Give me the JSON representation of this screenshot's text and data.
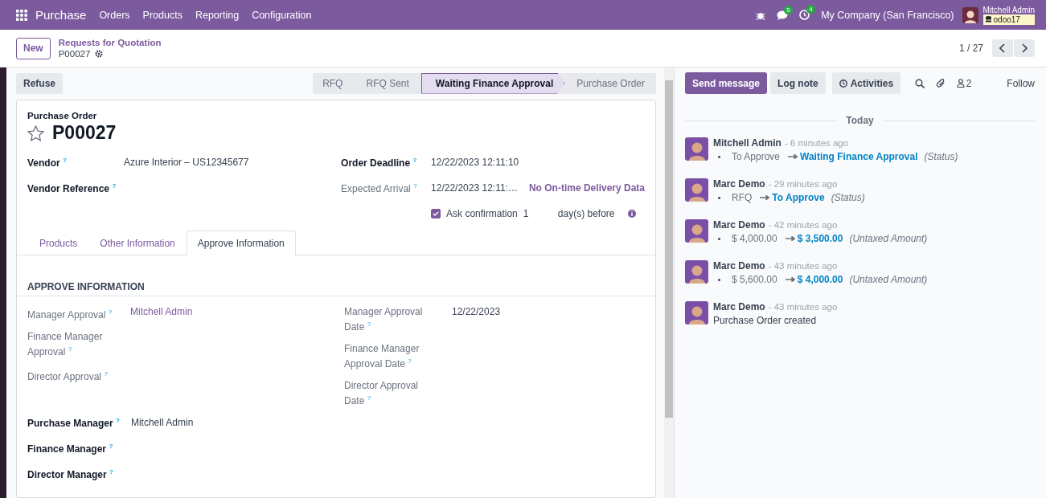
{
  "navbar": {
    "app_name": "Purchase",
    "menus": [
      "Orders",
      "Products",
      "Reporting",
      "Configuration"
    ],
    "messages_count": "5",
    "activities_count": "4",
    "company": "My Company (San Francisco)",
    "user_name": "Mitchell Admin",
    "database": "odoo17"
  },
  "control_panel": {
    "new_button": "New",
    "breadcrumb": "Requests for Quotation",
    "record": "P00027",
    "pager": "1 / 27"
  },
  "statusbar": {
    "refuse_button": "Refuse",
    "stages": [
      {
        "label": "RFQ",
        "selected": false
      },
      {
        "label": "RFQ Sent",
        "selected": false
      },
      {
        "label": "Waiting Finance Approval",
        "selected": true
      },
      {
        "label": "Purchase Order",
        "selected": false
      }
    ]
  },
  "form": {
    "title_label": "Purchase Order",
    "name": "P00027",
    "starred": false,
    "left_fields": [
      {
        "label": "Vendor $^{?}$",
        "value": "Azure Interior – US12345677",
        "bold": true
      },
      {
        "label": "Vendor Reference $^{?}$",
        "bold": true
      }
    ],
    "right_fields": [
      {
        "label": "Order Deadline $^{?}$",
        "value": "12/22/2023 12:11:10",
        "bold": true
      },
      {
        "label": "Expected Arrival $^{?}$",
        "value": "12/22/2023 12:11:…",
        "extra": "No On-time Delivery Data",
        "bold": false
      }
    ],
    "ask_confirmation": {
      "checked": true,
      "label": "Ask confirmation",
      "days": "1",
      "suffix": "day(s) before"
    },
    "tabs": [
      {
        "label": "Products",
        "selected": false
      },
      {
        "label": "Other Information",
        "selected": false
      },
      {
        "label": "Approve Information",
        "selected": true
      }
    ],
    "section_title": "APPROVE INFORMATION",
    "approve_left": [
      {
        "label": "Manager Approval $^{?}$",
        "value": "Mitchell Admin",
        "link": true
      },
      {
        "label": "Finance Manager Approval  $^{?}$"
      },
      {
        "label": "Director Approval $^{?}$"
      }
    ],
    "approve_right": [
      {
        "label": "Manager Approval Date $^{?}$",
        "value": "12/22/2023"
      },
      {
        "label": "Finance Manager Approval Date $^{?}$"
      },
      {
        "label": "Director Approval Date $^{?}$"
      }
    ],
    "managers": [
      {
        "label": "Purchase Manager $^{?}$",
        "value": "Mitchell Admin"
      },
      {
        "label": "Finance Manager $^{?}$"
      },
      {
        "label": "Director Manager $^{?}$"
      }
    ]
  },
  "chatter": {
    "send_button": "Send message",
    "log_button": "Log note",
    "activities_button": "Activities",
    "followers_count": "2",
    "follow": "Follow",
    "date": "Today",
    "messages": [
      {
        "kind": "tracking",
        "author": "Mitchell Admin",
        "time": "- 6 minutes ago",
        "old": "To Approve",
        "new": "Waiting Finance Approval",
        "field": "(Status)"
      },
      {
        "kind": "tracking",
        "author": "Marc Demo",
        "time": "- 29 minutes ago",
        "old": "RFQ",
        "new": "To Approve",
        "field": "(Status)"
      },
      {
        "kind": "tracking",
        "author": "Marc Demo",
        "time": "- 42 minutes ago",
        "old": "$ 4,000.00",
        "new": "$ 3,500.00",
        "field": "(Untaxed Amount)"
      },
      {
        "kind": "tracking",
        "author": "Marc Demo",
        "time": "- 43 minutes ago",
        "old": "$ 5,600.00",
        "new": "$ 4,000.00",
        "field": "(Untaxed Amount)"
      },
      {
        "kind": "note",
        "author": "Marc Demo",
        "time": "- 43 minutes ago",
        "body": "Purchase Order created"
      }
    ]
  }
}
